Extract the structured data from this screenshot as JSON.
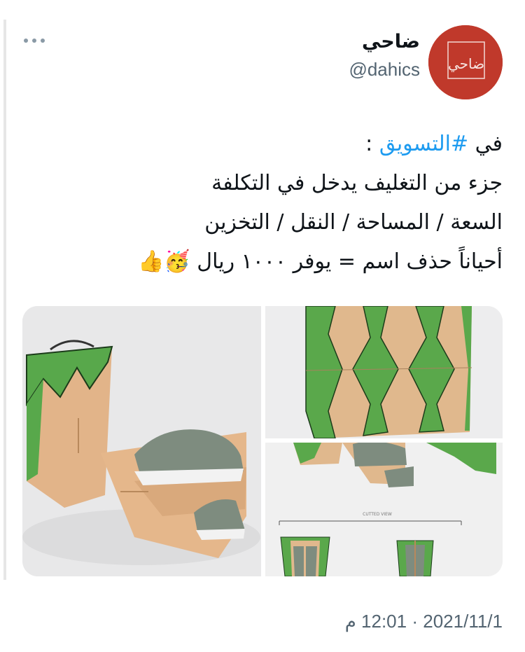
{
  "author": {
    "display_name": "ضاحي",
    "handle": "@dahics",
    "avatar_monogram": "ضاحي",
    "avatar_color": "#c0392b"
  },
  "tweet": {
    "line1_prefix": "في ",
    "hashtag": "#التسويق",
    "line1_suffix": " :",
    "line2": "جزء من التغليف يدخل في التكلفة",
    "line3": "السعة / المساحة / النقل / التخزين",
    "line4": "أحياناً حذف اسم = يوفر ١٠٠٠ ريال",
    "emoji_party": "🥳",
    "emoji_thumbs": "👍"
  },
  "media": {
    "cutted_view_label": "CUTTED VIEW"
  },
  "timestamp": {
    "date": "2021/11/1",
    "separator": "·",
    "time": "12:01 م"
  },
  "colors": {
    "hashtag": "#1d9bf0",
    "muted": "#536471",
    "kraft": "#e3b98a",
    "green": "#4caf50"
  }
}
